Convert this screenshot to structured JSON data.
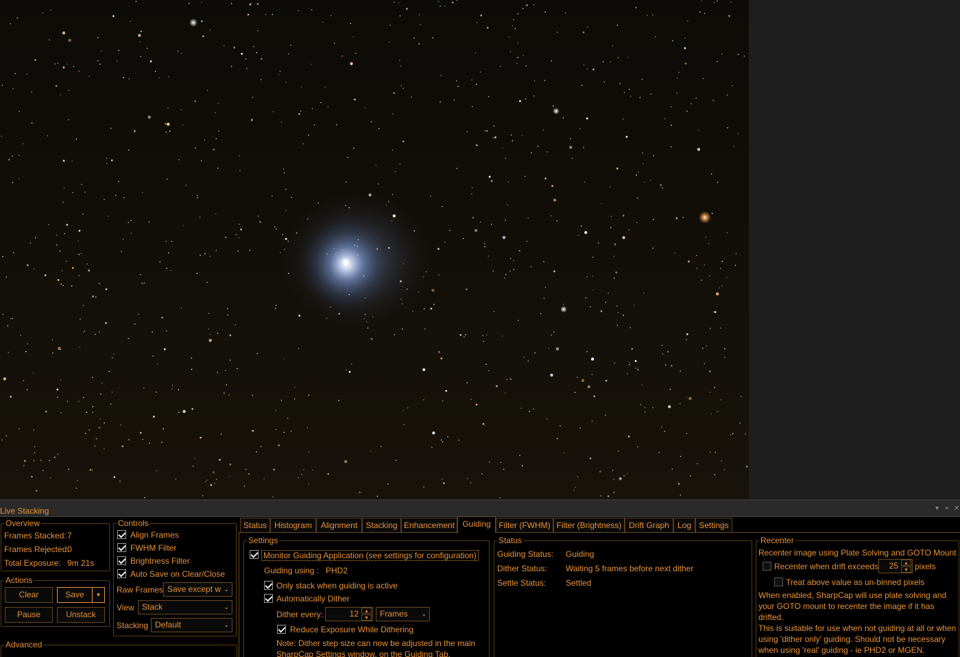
{
  "panel": {
    "title": "Live Stacking",
    "pin_glyph": "▾",
    "pin2_glyph": "⌖",
    "close_glyph": "✕"
  },
  "overview": {
    "legend": "Overview",
    "frames_stacked_label": "Frames Stacked:",
    "frames_stacked_value": "7",
    "frames_rejected_label": "Frames Rejected:",
    "frames_rejected_value": "0",
    "total_exposure_label": "Total Exposure:",
    "total_exposure_value": "9m 21s"
  },
  "actions": {
    "legend": "Actions",
    "clear": "Clear",
    "save": "Save",
    "save_dropdown": "▼",
    "pause": "Pause",
    "unstack": "Unstack"
  },
  "advanced": {
    "legend": "Advanced"
  },
  "controls": {
    "legend": "Controls",
    "align_frames": "Align Frames",
    "fwhm_filter": "FWHM Filter",
    "brightness_filter": "Brightness Filter",
    "auto_save": "Auto Save on Clear/Close",
    "raw_frames_label": "Raw Frames",
    "raw_frames_value": "Save except w",
    "view_label": "View",
    "view_value": "Stack",
    "stacking_label": "Stacking",
    "stacking_value": "Default"
  },
  "tabs": [
    "Status",
    "Histogram",
    "Alignment",
    "Stacking",
    "Enhancement",
    "Guiding",
    "Filter (FWHM)",
    "Filter (Brightness)",
    "Drift Graph",
    "Log",
    "Settings"
  ],
  "settings": {
    "legend": "Settings",
    "monitor_guiding": "Monitor Guiding Application (see settings for configuration)",
    "guiding_using_label": "Guiding using :",
    "guiding_using_value": "PHD2",
    "only_stack": "Only stack when guiding is active",
    "auto_dither": "Automatically Dither",
    "dither_every_label": "Dither every:",
    "dither_every_value": "12",
    "dither_unit": "Frames",
    "reduce_exposure": "Reduce Exposure While Dithering",
    "note_line1": "Note: Dither step size can now be adjusted in the main",
    "note_line2": "SharpCap Settings window, on the Guiding Tab."
  },
  "status": {
    "legend": "Status",
    "guiding_status_label": "Guiding Status:",
    "guiding_status_value": "Guiding",
    "dither_status_label": "Dither Status:",
    "dither_status_value": "Waiting 5 frames before next dither",
    "settle_status_label": "Settle Status:",
    "settle_status_value": "Settled"
  },
  "recenter": {
    "legend": "Recenter",
    "heading": "Recenter image using Plate Solving and GOTO Mount",
    "recenter_when": "Recenter when drift exceeds",
    "drift_value": "25",
    "pixels": "pixels",
    "treat_unbinned": "Treat above value as un-binned pixels",
    "desc1": "When enabled, SharpCap will use plate solving and",
    "desc2": "your GOTO mount to recenter the image if it has",
    "desc3": "drifted.",
    "desc4": "This is suitable for use when not guiding at all or when",
    "desc5": "using 'dither only' guiding. Should not be necessary",
    "desc6": "when using 'real' guiding - ie PHD2 or MGEN."
  },
  "colors": {
    "accent": "#e8923a",
    "background": "#000000",
    "border": "#5a3b1a"
  }
}
